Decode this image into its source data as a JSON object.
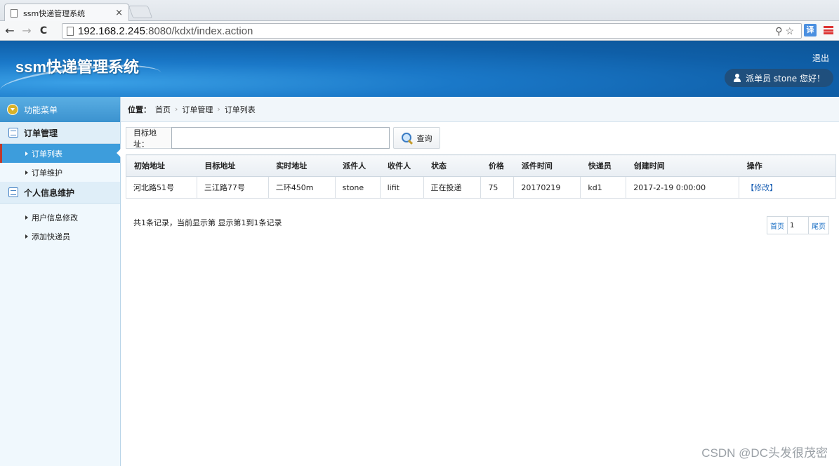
{
  "browser": {
    "tab_title": "ssm快递管理系统",
    "tab_close": "×",
    "back": "←",
    "forward": "→",
    "reload": "C",
    "url_host": "192.168.2.245",
    "url_path": ":8080/kdxt/index.action",
    "translate": "译"
  },
  "header": {
    "title": "ssm快递管理系统",
    "logout": "退出",
    "user_greeting": "派单员 stone 您好！"
  },
  "sidebar": {
    "menu_title": "功能菜单",
    "groups": [
      {
        "label": "订单管理",
        "items": [
          {
            "label": "订单列表",
            "active": true
          },
          {
            "label": "订单维护"
          }
        ]
      },
      {
        "label": "个人信息维护",
        "items": [
          {
            "label": "用户信息修改"
          },
          {
            "label": "添加快递员"
          }
        ]
      }
    ]
  },
  "breadcrumb": {
    "label": "位置：",
    "items": [
      "首页",
      "订单管理",
      "订单列表"
    ],
    "sep": "›"
  },
  "search": {
    "label": "目标地址：",
    "value": "",
    "button": "查询"
  },
  "table": {
    "columns": [
      "初始地址",
      "目标地址",
      "实时地址",
      "派件人",
      "收件人",
      "状态",
      "价格",
      "派件时间",
      "快递员",
      "创建时间",
      "操作"
    ],
    "rows": [
      [
        "河北路51号",
        "三江路77号",
        "二环450m",
        "stone",
        "lifit",
        "正在投递",
        "75",
        "20170219",
        "kd1",
        "2017-2-19 0:00:00",
        "【修改】"
      ]
    ]
  },
  "pager": {
    "info": "共1条记录，当前显示第  显示第1到1条记录",
    "first": "首页",
    "page": "1",
    "last": "尾页"
  },
  "watermark": "CSDN @DC头发很茂密"
}
